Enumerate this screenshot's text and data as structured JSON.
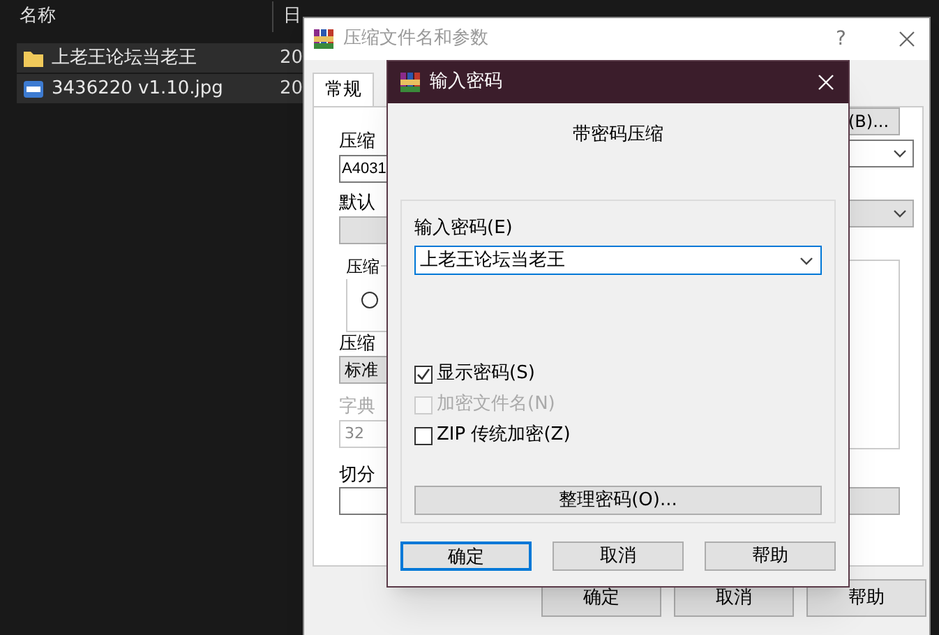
{
  "explorer": {
    "columns": [
      "名称",
      "日"
    ],
    "files": [
      {
        "name": "上老王论坛当老王",
        "kind": "folder",
        "date": "20",
        "selected": true
      },
      {
        "name": "3436220 v1.10.jpg",
        "kind": "image",
        "date": "20",
        "selected": true
      }
    ]
  },
  "archive_dialog": {
    "title": "压缩文件名和参数",
    "help": "?",
    "tabs": [
      {
        "label": "常规",
        "selected": true
      }
    ],
    "archive_name_label": "压缩",
    "archive_name_value": "A4031",
    "browse_button": "(B)...",
    "profile_label": "默认",
    "group_label": "压缩",
    "radio": {
      "selected": false
    },
    "method_label": "压缩",
    "method_value": "标准",
    "dictionary_label": "字典",
    "dictionary_value": "32",
    "split_label": "切分",
    "buttons": [
      "确定",
      "取消",
      "帮助"
    ]
  },
  "password_dialog": {
    "title": "输入密码",
    "heading": "带密码压缩",
    "password_label": "输入密码(E)",
    "password_value": "上老王论坛当老王",
    "options": [
      {
        "label": "显示密码(S)",
        "checked": true,
        "disabled": false
      },
      {
        "label": "加密文件名(N)",
        "checked": false,
        "disabled": true
      },
      {
        "label": "ZIP 传统加密(Z)",
        "checked": false,
        "disabled": false
      }
    ],
    "organize_button": "整理密码(O)...",
    "buttons": [
      {
        "label": "确定",
        "focused": true
      },
      {
        "label": "取消",
        "focused": false
      },
      {
        "label": "帮助",
        "focused": false
      }
    ]
  }
}
